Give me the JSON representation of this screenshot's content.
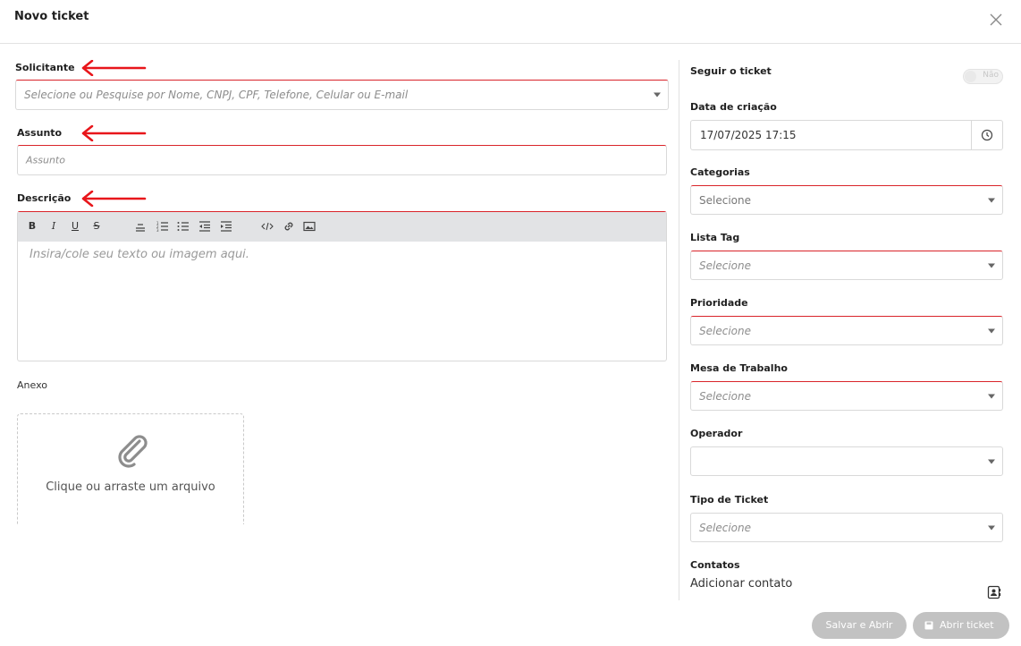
{
  "header": {
    "title": "Novo ticket"
  },
  "left": {
    "solicitante": {
      "label": "Solicitante",
      "placeholder": "Selecione ou Pesquise por Nome, CNPJ, CPF, Telefone, Celular ou E-mail"
    },
    "assunto": {
      "label": "Assunto",
      "placeholder": "Assunto"
    },
    "descricao": {
      "label": "Descrição",
      "placeholder": "Insira/cole seu texto ou imagem aqui."
    },
    "anexo": {
      "label": "Anexo",
      "dropzone_text": "Clique ou arraste um arquivo"
    }
  },
  "toolbar": {
    "bold": "B",
    "italic": "I",
    "underline": "U",
    "strike": "S"
  },
  "right": {
    "seguir": {
      "label": "Seguir o ticket",
      "toggle_text": "Não"
    },
    "data_criacao": {
      "label": "Data de criação",
      "value": "17/07/2025 17:15"
    },
    "categorias": {
      "label": "Categorias",
      "value": "Selecione"
    },
    "lista_tag": {
      "label": "Lista Tag",
      "placeholder": "Selecione"
    },
    "prioridade": {
      "label": "Prioridade",
      "placeholder": "Selecione"
    },
    "mesa": {
      "label": "Mesa de Trabalho",
      "placeholder": "Selecione"
    },
    "operador": {
      "label": "Operador",
      "value": ""
    },
    "tipo": {
      "label": "Tipo de Ticket",
      "placeholder": "Selecione"
    },
    "contatos": {
      "label": "Contatos",
      "link": "Adicionar contato"
    }
  },
  "footer": {
    "save_open": "Salvar e Abrir",
    "open_ticket": "Abrir ticket"
  },
  "colors": {
    "accent_red": "#d9242a",
    "annotation_arrow": "#e8161b",
    "button_disabled": "#c2c2c2"
  }
}
